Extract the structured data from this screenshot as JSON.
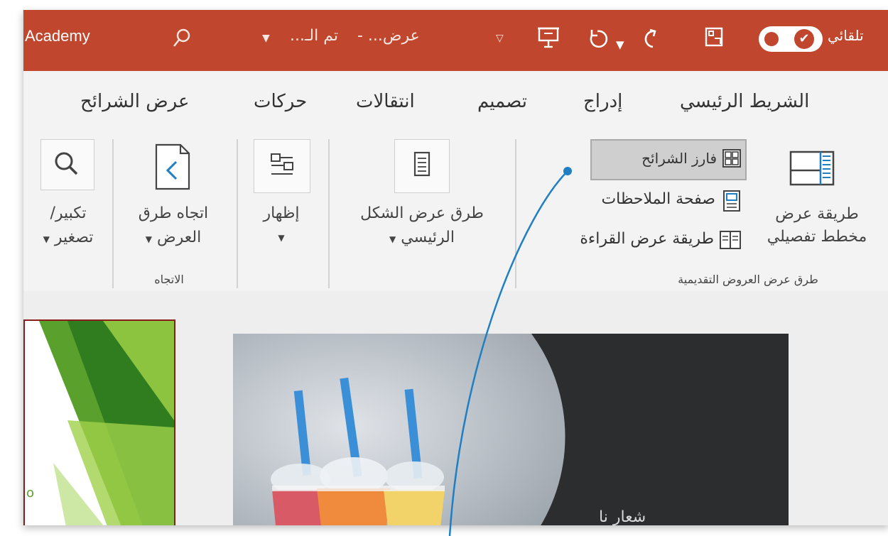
{
  "titlebar": {
    "app_fragment": "Academy",
    "file_fragment": "تم الـ...",
    "doc_fragment": "عرض... -",
    "autosave_fragment": "تلقائي",
    "icons": [
      "search-icon",
      "dropdown-icon",
      "present-icon",
      "undo-icon",
      "redo-icon",
      "slides-icon",
      "autosave-toggle"
    ]
  },
  "tabs": [
    "الشريط الرئيسي",
    "إدراج",
    "تصميم",
    "انتقالات",
    "حركات",
    "عرض الشرائح"
  ],
  "ribbon": {
    "presentation_views": {
      "normal_label_line1": "طريقة عرض",
      "normal_label_line2": "مخطط تفصيلي",
      "slide_sorter": "فارز الشرائح",
      "notes_page": "صفحة الملاحظات",
      "reading_view": "طريقة عرض القراءة",
      "group_label": "طرق عرض العروض التقديمية"
    },
    "master_views": {
      "label_line1": "طرق عرض الشكل",
      "label_line2": "الرئيسي"
    },
    "show": {
      "label": "إظهار"
    },
    "direction": {
      "label_line1": "اتجاه طرق",
      "label_line2": "العرض",
      "group_label": "الاتجاه"
    },
    "zoom": {
      "label_line1": "تكبير/",
      "label_line2": "تصغير"
    }
  },
  "slide": {
    "text": "شعار نا"
  },
  "colors": {
    "titlebar": "#c0462d",
    "ribbon": "#f3f3f3",
    "slide_dark": "#2c2d2e",
    "annotation_line": "#1f7fc2"
  }
}
